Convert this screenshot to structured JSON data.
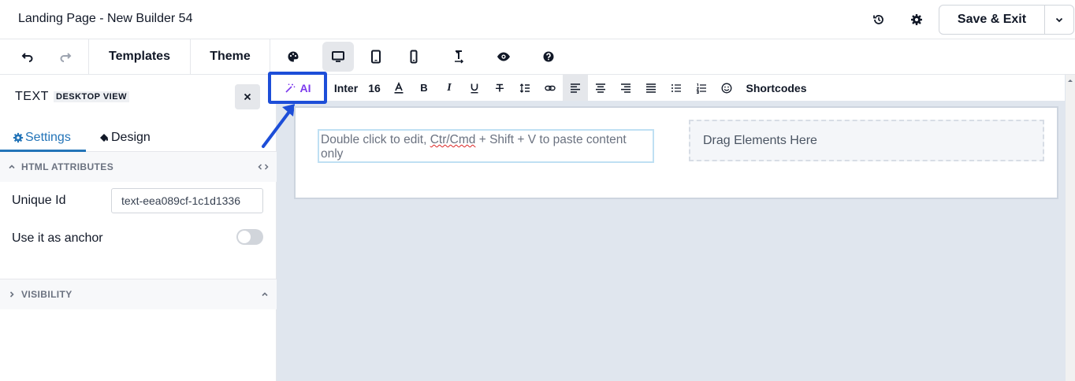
{
  "header": {
    "title": "Landing Page - New Builder 54",
    "history_icon": "history-icon",
    "settings_icon": "gear-icon",
    "save_label": "Save & Exit",
    "save_menu_icon": "chevron-down-icon"
  },
  "toolbar": {
    "undo_icon": "undo-icon",
    "redo_icon": "redo-icon",
    "templates_label": "Templates",
    "theme_label": "Theme",
    "palette_icon": "palette-icon",
    "devices": [
      "desktop-icon",
      "tablet-icon",
      "mobile-icon"
    ],
    "active_device": "desktop",
    "paragraph_icon": "paragraph-icon",
    "preview_icon": "eye-icon",
    "help_icon": "help-icon"
  },
  "panel": {
    "title": "TEXT",
    "view_badge": "DESKTOP VIEW",
    "tabs": [
      {
        "label": "Settings",
        "icon": "gear-icon",
        "active": true
      },
      {
        "label": "Design",
        "icon": "paint-bucket-icon",
        "active": false
      }
    ],
    "sections": {
      "html_attributes": "HTML ATTRIBUTES",
      "visibility": "VISIBILITY"
    },
    "unique_id_label": "Unique Id",
    "unique_id_value": "text-eea089cf-1c1d1336",
    "anchor_label": "Use it as anchor",
    "anchor_enabled": false
  },
  "format_bar": {
    "ai_label": "AI",
    "font_family": "Inter",
    "font_size": "16",
    "shortcodes_label": "Shortcodes",
    "tools": [
      "text-color-icon",
      "bold-icon",
      "italic-icon",
      "underline-icon",
      "strikethrough-icon",
      "line-height-icon",
      "link-icon",
      "align-left-icon",
      "align-center-icon",
      "align-right-icon",
      "align-justify-icon",
      "bullet-list-icon",
      "numbered-list-icon",
      "emoji-icon"
    ],
    "active_tool": "align-left-icon"
  },
  "canvas": {
    "text_before": "Double click to edit, ",
    "text_misspelled": "Ctr/Cmd",
    "text_after": " + Shift + V to paste content only",
    "drop_zone_label": "Drag Elements Here"
  },
  "colors": {
    "accent": "#2374b8",
    "highlight_border": "#1d4ed8",
    "ai_purple": "#7c3aed",
    "canvas_bg": "#e0e6ee"
  }
}
